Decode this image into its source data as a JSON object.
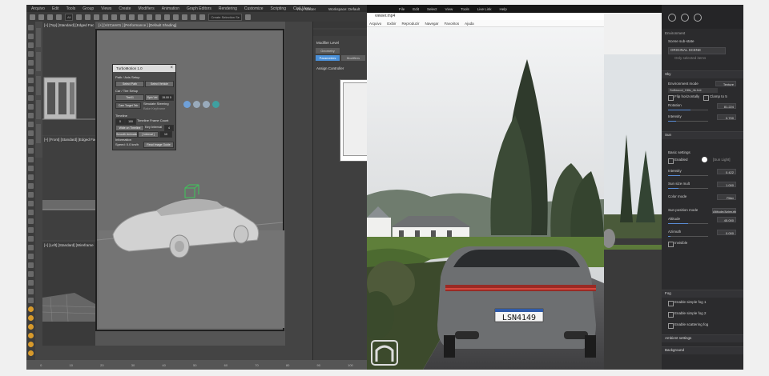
{
  "max": {
    "menu": [
      "Arquivo",
      "Edit",
      "Tools",
      "Group",
      "Views",
      "Create",
      "Modifiers",
      "Animation",
      "Graph Editors",
      "Rendering",
      "Customize",
      "Scripting",
      "Civil View"
    ],
    "toolbar_field": "All",
    "toolbar_search": "Create Selection Se",
    "viewport_top_label": "[+] [Top] [Standard] [Edged Fac",
    "viewport_cam_label": "[+] [VizCam01 ] [Performance ] [Default Shading]",
    "viewport_front_label": "[+] [Front] [Standard] [Edged Fac",
    "viewport_left_label": "[+] [Left] [Standard] [Wireframe",
    "dialog": {
      "title": "TurboMotion 1.0",
      "section1": "Path / Axis Setup",
      "btn_select_path": "Select Path",
      "btn_select_vehicle": "Select Vehicle",
      "section2": "Car / Tire Setup",
      "btn_tire": "Tire01",
      "btn_spin": "Spin Vel",
      "spin_val": "15.00 0",
      "btn_auto": "Cam Target Tab",
      "chk_simulate": "Simulate Steering",
      "chk_keyframe": "Bake Keyframe",
      "section3": "Timeline",
      "tl_start": "0",
      "tl_end": "100",
      "tl_frame": "Timeline Frame Count",
      "btn_wide": "Wide on Timeline",
      "key_interval": "Key Interval",
      "key_val": "4",
      "btn_smooth": "Smooth Animation",
      "btn_interval": "[ Interval ]",
      "interval_val": "10",
      "section4": "Information",
      "speed_label": "Speed: 0.0 km/h",
      "btn_guide": "Read Image Guide"
    },
    "cmd_panel": {
      "title": "Modifier Level",
      "tab1": "Geometry",
      "tab2": "Parameters",
      "tab3": "Modifiers",
      "section": "Assign Controller"
    },
    "timeline_ticks": [
      "0",
      "10",
      "20",
      "30",
      "40",
      "50",
      "60",
      "70",
      "80",
      "90",
      "100"
    ]
  },
  "topbar": {
    "items": [
      "File",
      "Edit",
      "Select",
      "View",
      "Tools",
      "Live Link",
      "Help"
    ],
    "workspace_label": "Vray Master",
    "workspace2": "Workspace: Default"
  },
  "player": {
    "title": "viewer.mp4",
    "menu": [
      "Arquivo",
      "Exibir",
      "Reproduzir",
      "Navegar",
      "Favoritos",
      "Ajuda"
    ],
    "plate": "LSN4149"
  },
  "env": {
    "heading": "Environment",
    "scene_sub_state": "Scene sub-state",
    "original_scene": "ORIGINAL SCENE",
    "only_selected": "Only selected items",
    "sky": "Sky",
    "env_mode_label": "Environment mode",
    "env_mode_val": "Texture",
    "hdr_file": "Softwood_Hills_4k.hdr",
    "flip_horizontally": "Flip horizontally",
    "clamp": "Clamp to 5",
    "rotation_label": "Rotation",
    "rotation_val": "81.224",
    "intensity_label": "Intensity",
    "intensity_val": "0.700",
    "sun": "Sun",
    "basic_settings": "Basic settings",
    "enabled": "Enabled",
    "sun_color_label": "[Sun Light]",
    "sun_intensity_label": "Intensity",
    "sun_intensity_val": "0.422",
    "sun_size_label": "Sun size mult",
    "sun_size_val": "1.000",
    "color_mode_label": "Color mode",
    "color_mode_val": "Filter",
    "sun_pos_label": "Sun position mode",
    "sun_pos_val": "Altitude/Azimuth",
    "altitude_label": "Altitude",
    "altitude_val": "45.000",
    "azimuth_label": "Azimuth",
    "azimuth_val": "0.000",
    "invisible": "Invisible",
    "fog": "Fog",
    "fog1": "Enable simple fog 1",
    "fog2": "Enable simple fog 2",
    "fog3": "Enable scattering fog",
    "ambient": "Ambient settings",
    "background": "Background",
    "progress": {
      "rotation": 0.55,
      "intensity": 0.2,
      "sun_intensity": 0.3,
      "sun_size": 0.25,
      "altitude": 0.5,
      "azimuth": 0.05
    }
  }
}
